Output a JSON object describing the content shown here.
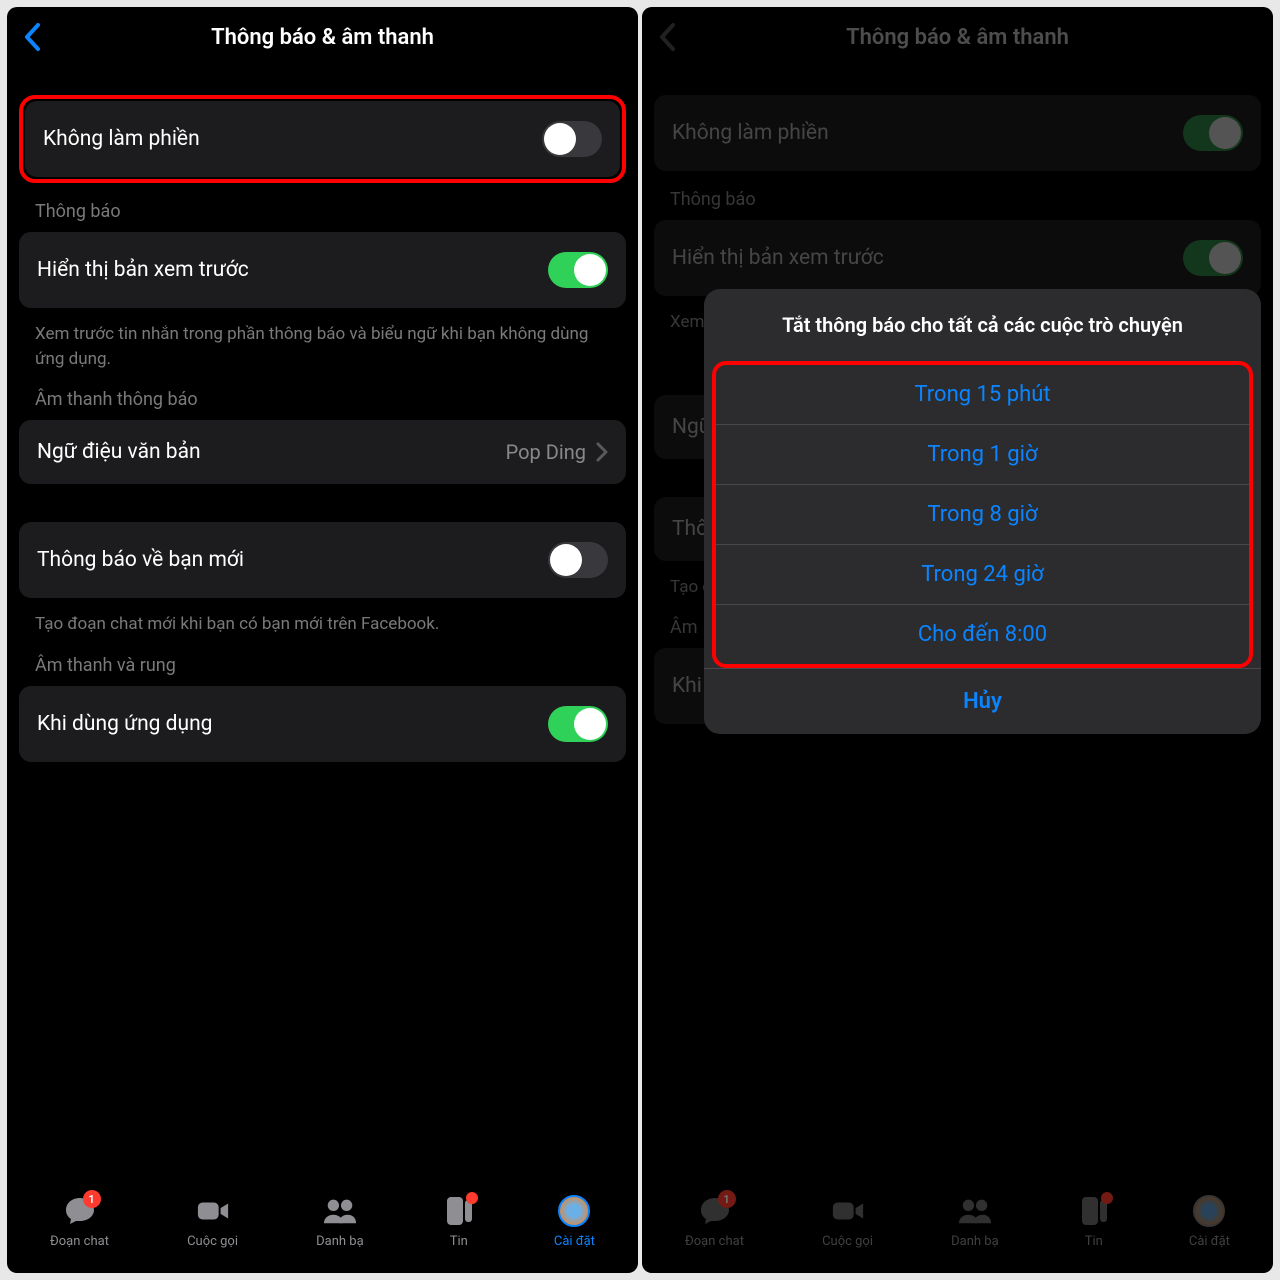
{
  "left": {
    "header": {
      "title": "Thông báo & âm thanh"
    },
    "dnd": {
      "label": "Không làm phiền"
    },
    "sec_notif": {
      "title": "Thông báo"
    },
    "preview": {
      "label": "Hiển thị bản xem trước",
      "desc": "Xem trước tin nhắn trong phần thông báo và biểu ngữ khi bạn không dùng ứng dụng."
    },
    "sec_sound": {
      "title": "Âm thanh thông báo"
    },
    "tone": {
      "label": "Ngữ điệu văn bản",
      "value": "Pop Ding"
    },
    "newfriend": {
      "label": "Thông báo về bạn mới",
      "desc": "Tạo đoạn chat mới khi bạn có bạn mới trên Facebook."
    },
    "sec_vib": {
      "title": "Âm thanh và rung"
    },
    "inapp": {
      "label": "Khi dùng ứng dụng"
    },
    "tabs": {
      "chat": {
        "label": "Đoạn chat",
        "badge": "1"
      },
      "calls": {
        "label": "Cuộc gọi"
      },
      "people": {
        "label": "Danh bạ"
      },
      "stories": {
        "label": "Tin"
      },
      "settings": {
        "label": "Cài đặt"
      }
    }
  },
  "right": {
    "header": {
      "title": "Thông báo & âm thanh"
    },
    "dnd": {
      "label": "Không làm phiền"
    },
    "sec_notif": {
      "title": "Thông báo"
    },
    "preview": {
      "label": "Hiển thị bản xem trước",
      "desc": "Xem"
    },
    "tone": {
      "label": "Ngữ"
    },
    "newfriend": {
      "label": "Thô",
      "desc": "Tạo đ"
    },
    "sec_vib": {
      "title": "Âm"
    },
    "inapp": {
      "label": "Khi dùng ứng dụng"
    },
    "sheet": {
      "title": "Tắt thông báo cho tất cả các cuộc trò chuyện",
      "opt1": "Trong 15 phút",
      "opt2": "Trong 1 giờ",
      "opt3": "Trong 8 giờ",
      "opt4": "Trong 24 giờ",
      "opt5": "Cho đến 8:00",
      "cancel": "Hủy"
    },
    "tabs": {
      "chat": {
        "label": "Đoạn chat",
        "badge": "1"
      },
      "calls": {
        "label": "Cuộc gọi"
      },
      "people": {
        "label": "Danh bạ"
      },
      "stories": {
        "label": "Tin"
      },
      "settings": {
        "label": "Cài đặt"
      }
    }
  }
}
